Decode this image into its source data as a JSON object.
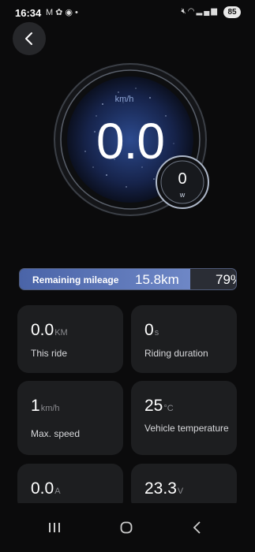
{
  "status_bar": {
    "time": "16:34",
    "left_icons": [
      "mail-icon",
      "photos-icon",
      "chrome-icon",
      "dot-icon"
    ],
    "right_icons": [
      "mute-icon",
      "wifi-icon",
      "signal-icon"
    ],
    "battery": "85"
  },
  "gauge": {
    "speed": "0.0",
    "speed_unit": "km/h",
    "power_value": "0",
    "power_unit": "w"
  },
  "mileage": {
    "label": "Remaining mileage",
    "value": "15.8km",
    "percent": "79%",
    "fill_fraction": 0.79
  },
  "cards": [
    {
      "value": "0.0",
      "unit": "KM",
      "label": "This ride"
    },
    {
      "value": "0",
      "unit": "s",
      "label": "Riding duration"
    },
    {
      "value": "1",
      "unit": "km/h",
      "label": "Max. speed"
    },
    {
      "value": "25",
      "unit": "°C",
      "label": "Vehicle temperature"
    },
    {
      "value": "0.0",
      "unit": "A",
      "label": ""
    },
    {
      "value": "23.3",
      "unit": "V",
      "label": ""
    }
  ],
  "colors": {
    "background": "#0b0b0c",
    "card": "#1d1e20",
    "accent": "#6e87c6"
  },
  "nav": [
    "recents-icon",
    "home-icon",
    "back-nav-icon"
  ]
}
